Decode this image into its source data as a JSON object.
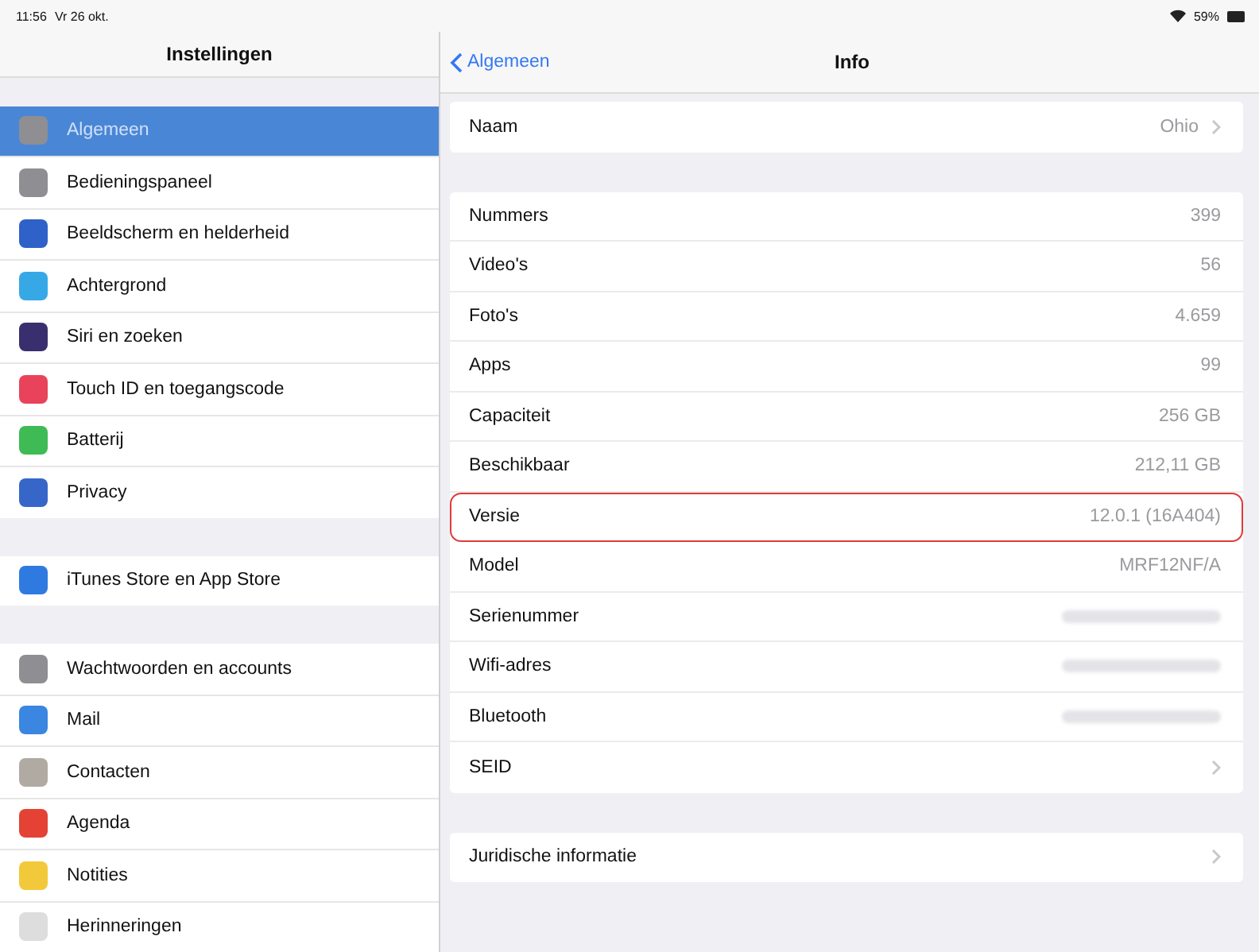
{
  "status_bar": {
    "time": "11:56",
    "date": "Vr 26 okt.",
    "battery": "59%"
  },
  "sidebar": {
    "title": "Instellingen",
    "groups": [
      {
        "items": [
          {
            "label": "Algemeen",
            "selected": true,
            "color": "#8e8e93"
          },
          {
            "label": "Bedieningspaneel",
            "selected": false,
            "color": "#8e8e93"
          },
          {
            "label": "Beeldscherm en helderheid",
            "selected": false,
            "color": "#2f62c8"
          },
          {
            "label": "Achtergrond",
            "selected": false,
            "color": "#37a8e6"
          },
          {
            "label": "Siri en zoeken",
            "selected": false,
            "color": "#3a2f6e"
          },
          {
            "label": "Touch ID en toegangscode",
            "selected": false,
            "color": "#e8435a"
          },
          {
            "label": "Batterij",
            "selected": false,
            "color": "#3ebb54"
          },
          {
            "label": "Privacy",
            "selected": false,
            "color": "#3667c8"
          }
        ]
      },
      {
        "items": [
          {
            "label": "iTunes Store en App Store",
            "selected": false,
            "color": "#2f7ae0"
          }
        ]
      },
      {
        "items": [
          {
            "label": "Wachtwoorden en accounts",
            "selected": false,
            "color": "#8e8e93"
          },
          {
            "label": "Mail",
            "selected": false,
            "color": "#3a86e0"
          },
          {
            "label": "Contacten",
            "selected": false,
            "color": "#b0aaa2"
          },
          {
            "label": "Agenda",
            "selected": false,
            "color": "#e34234"
          },
          {
            "label": "Notities",
            "selected": false,
            "color": "#f2c93a"
          },
          {
            "label": "Herinneringen",
            "selected": false,
            "color": "#dddddd"
          }
        ]
      }
    ]
  },
  "detail": {
    "back": "Algemeen",
    "title": "Info",
    "groups": [
      {
        "rows": [
          {
            "label": "Naam",
            "kind": "text",
            "value": "Ohio",
            "chevron": true,
            "highlighted": false
          }
        ]
      },
      {
        "rows": [
          {
            "label": "Nummers",
            "kind": "text",
            "value": "399",
            "chevron": false,
            "highlighted": false
          },
          {
            "label": "Video's",
            "kind": "text",
            "value": "56",
            "chevron": false,
            "highlighted": false
          },
          {
            "label": "Foto's",
            "kind": "text",
            "value": "4.659",
            "chevron": false,
            "highlighted": false
          },
          {
            "label": "Apps",
            "kind": "text",
            "value": "99",
            "chevron": false,
            "highlighted": false
          },
          {
            "label": "Capaciteit",
            "kind": "text",
            "value": "256 GB",
            "chevron": false,
            "highlighted": false
          },
          {
            "label": "Beschikbaar",
            "kind": "text",
            "value": "212,11 GB",
            "chevron": false,
            "highlighted": false
          },
          {
            "label": "Versie",
            "kind": "text",
            "value": "12.0.1 (16A404)",
            "chevron": false,
            "highlighted": true
          },
          {
            "label": "Model",
            "kind": "text",
            "value": "MRF12NF/A",
            "chevron": false,
            "highlighted": false
          },
          {
            "label": "Serienummer",
            "kind": "redacted",
            "chevron": false,
            "highlighted": false
          },
          {
            "label": "Wifi-adres",
            "kind": "redacted",
            "chevron": false,
            "highlighted": false
          },
          {
            "label": "Bluetooth",
            "kind": "redacted",
            "chevron": false,
            "highlighted": false
          },
          {
            "label": "SEID",
            "kind": "text",
            "chevron": true,
            "highlighted": false
          }
        ]
      },
      {
        "rows": [
          {
            "label": "Juridische informatie",
            "kind": "text",
            "chevron": true,
            "highlighted": false
          }
        ]
      }
    ]
  }
}
